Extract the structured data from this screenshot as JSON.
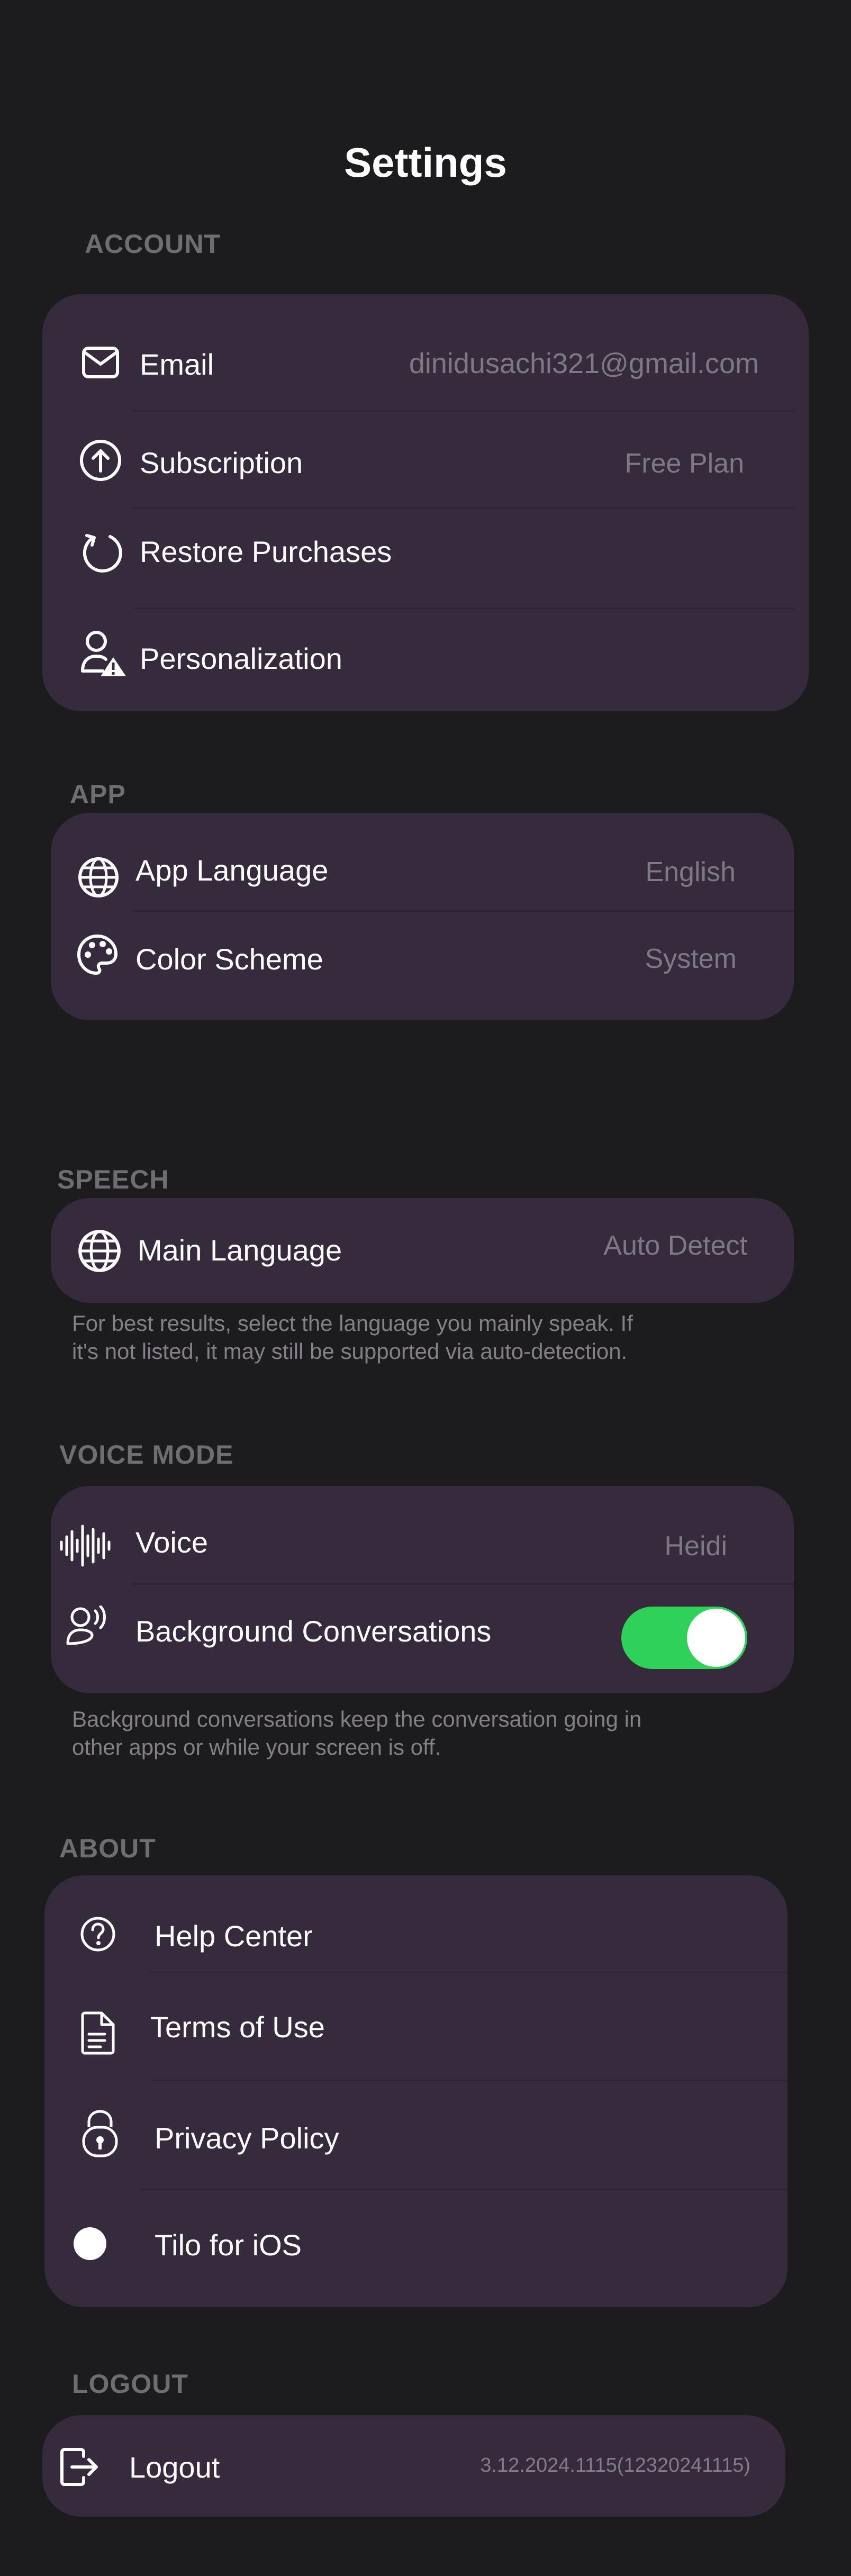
{
  "page_title": "Settings",
  "account": {
    "section_label": "ACCOUNT",
    "email": {
      "label": "Email",
      "value": "dinidusachi321@gmail.com",
      "icon": "envelope-icon"
    },
    "subscription": {
      "label": "Subscription",
      "value": "Free Plan",
      "icon": "arrow-up-circle-icon"
    },
    "restore": {
      "label": "Restore Purchases",
      "icon": "refresh-icon"
    },
    "personalization": {
      "label": "Personalization",
      "icon": "person-warning-icon"
    }
  },
  "app": {
    "section_label": "APP",
    "language": {
      "label": "App Language",
      "value": "English",
      "icon": "globe-icon"
    },
    "color_scheme": {
      "label": "Color Scheme",
      "value": "System",
      "icon": "palette-icon"
    }
  },
  "speech": {
    "section_label": "SPEECH",
    "main_language": {
      "label": "Main Language",
      "value": "Auto Detect",
      "icon": "globe-icon"
    },
    "footnote_line1": "For best results, select the language you mainly speak. If",
    "footnote_line2": "it's not listed, it may still be supported via auto-detection."
  },
  "voice_mode": {
    "section_label": "VOICE MODE",
    "voice": {
      "label": "Voice",
      "value": "Heidi",
      "icon": "waveform-icon"
    },
    "background": {
      "label": "Background Conversations",
      "enabled": true,
      "icon": "speaking-head-icon"
    },
    "footnote_line1": "Background conversations keep the conversation going in",
    "footnote_line2": "other apps or while your screen is off."
  },
  "about": {
    "section_label": "ABOUT",
    "help": {
      "label": "Help Center",
      "icon": "question-circle-icon"
    },
    "terms": {
      "label": "Terms of Use",
      "icon": "document-icon"
    },
    "privacy": {
      "label": "Privacy Policy",
      "icon": "lock-icon"
    },
    "tilo": {
      "label": "Tilo for iOS",
      "icon": "dot-icon"
    }
  },
  "logout": {
    "section_label": "LOGOUT",
    "label": "Logout",
    "version": "3.12.2024.1115(12320241115)",
    "icon": "logout-icon"
  },
  "colors": {
    "background": "#1c1c1e",
    "card": "#362b3c",
    "toggle_on": "#30d158",
    "section_label": "#6f6c72",
    "secondary_text": "#7e7882"
  }
}
